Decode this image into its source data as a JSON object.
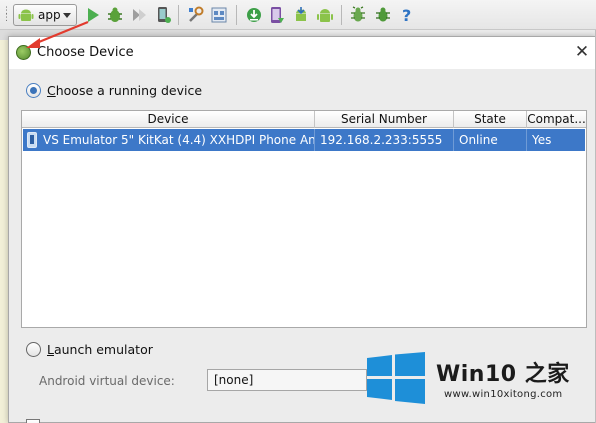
{
  "toolbar": {
    "run_config": "app",
    "icons": [
      "run-icon",
      "debug-icon",
      "attach-debugger-icon",
      "device-monitor-icon",
      "project-structure-icon",
      "sdk-manager-icon",
      "sync-gradle-icon",
      "avd-manager-icon",
      "sdk-icon",
      "android-icon",
      "debug-bug-icon",
      "help-icon"
    ],
    "help_label": "?"
  },
  "dialog": {
    "title": "Choose Device",
    "close_label": "✕",
    "choose_running": {
      "mnemonic": "C",
      "rest": "hoose a running device",
      "selected": true
    },
    "table": {
      "columns": [
        "Device",
        "Serial Number",
        "State",
        "Compat..."
      ],
      "rows": [
        {
          "device": "VS Emulator 5\" KitKat (4.4) XXHDPI Phone Andr",
          "serial": "192.168.2.233:5555",
          "state": "Online",
          "compat": "Yes",
          "selected": true
        }
      ]
    },
    "launch_emulator": {
      "mnemonic": "L",
      "rest": "aunch emulator",
      "selected": false
    },
    "avd_label": "Android virtual device:",
    "avd_value": "[none]"
  },
  "watermark": {
    "title": "Win10 之家",
    "url": "www.win10xitong.com"
  },
  "colors": {
    "selection": "#3d78c8",
    "radio_dot": "#3b73b9",
    "win_logo": "#1e8fd8",
    "arrow": "#e23b2e"
  }
}
